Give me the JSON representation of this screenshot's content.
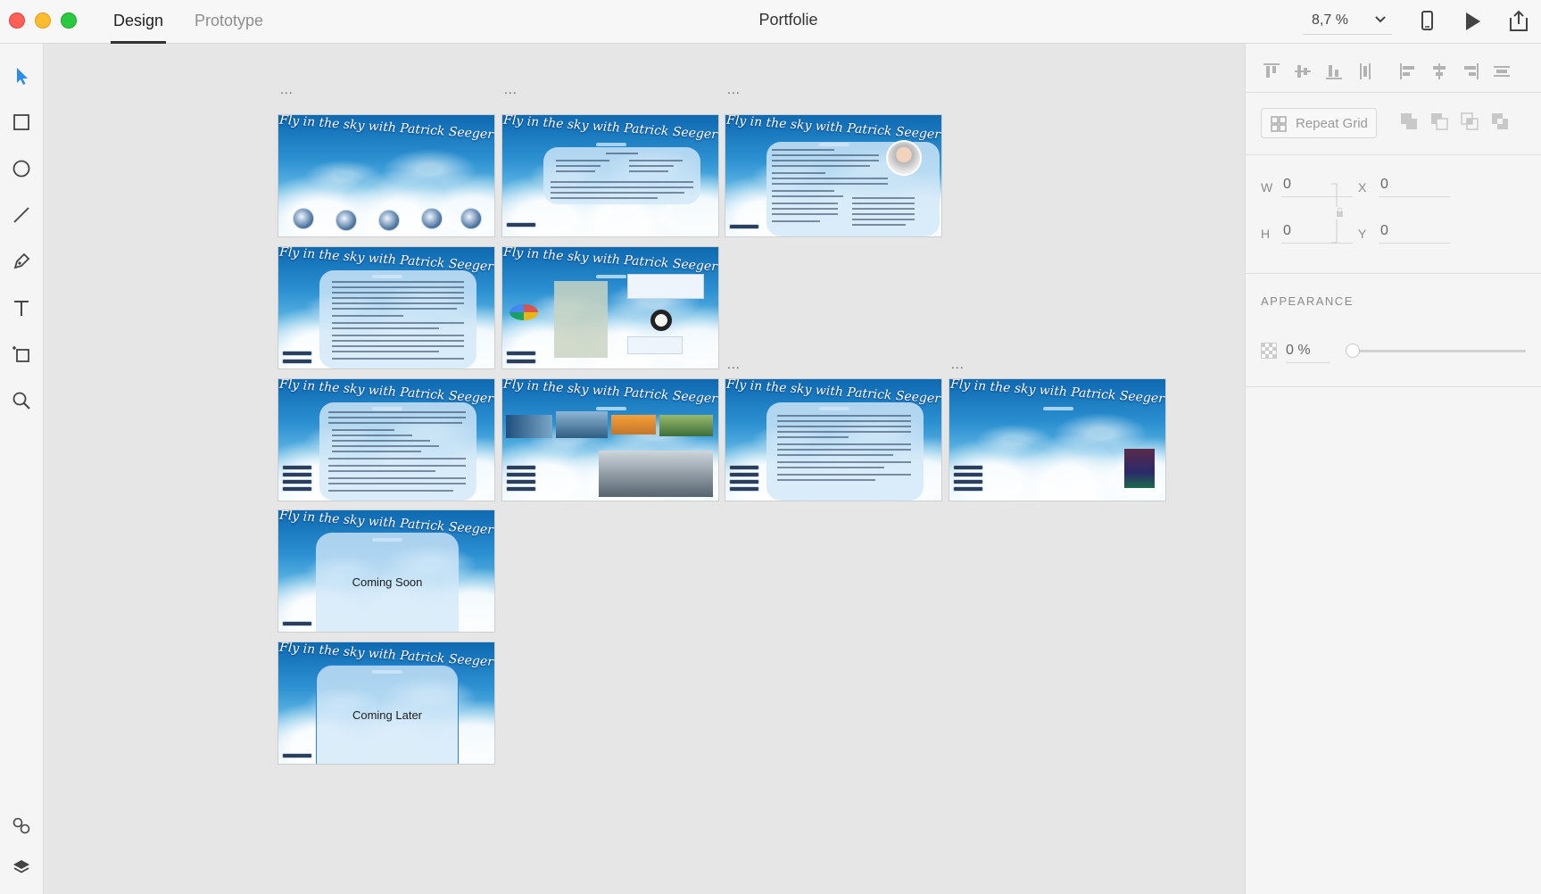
{
  "window": {
    "title": "Portfolie",
    "tabs": [
      {
        "label": "Design",
        "active": true
      },
      {
        "label": "Prototype",
        "active": false
      }
    ],
    "zoom": "8,7 %"
  },
  "properties": {
    "repeat_grid_label": "Repeat Grid",
    "w_label": "W",
    "w_value": "0",
    "h_label": "H",
    "h_value": "0",
    "x_label": "X",
    "x_value": "0",
    "y_label": "Y",
    "y_value": "0",
    "appearance_title": "APPEARANCE",
    "opacity_value": "0 %",
    "opacity_level": 0
  },
  "artboards": {
    "title_text": "Fly in the sky with Patrick Seeger",
    "dots": "...",
    "coming_soon": "Coming Soon",
    "coming_later": "Coming Later"
  },
  "colors": {
    "accent": "#2f7fe0",
    "selection_tool": "#2d8ceb",
    "sky_dark": "#0e69b1",
    "sky_light": "#e9f6fb"
  },
  "icons": {
    "tools": [
      "select-arrow-icon",
      "rectangle-icon",
      "ellipse-icon",
      "line-icon",
      "pen-icon",
      "text-icon",
      "artboard-icon",
      "zoom-icon"
    ],
    "bottom_tools": [
      "assets-icon",
      "layers-icon"
    ],
    "window": [
      "device-preview-icon",
      "play-icon",
      "share-icon"
    ]
  }
}
